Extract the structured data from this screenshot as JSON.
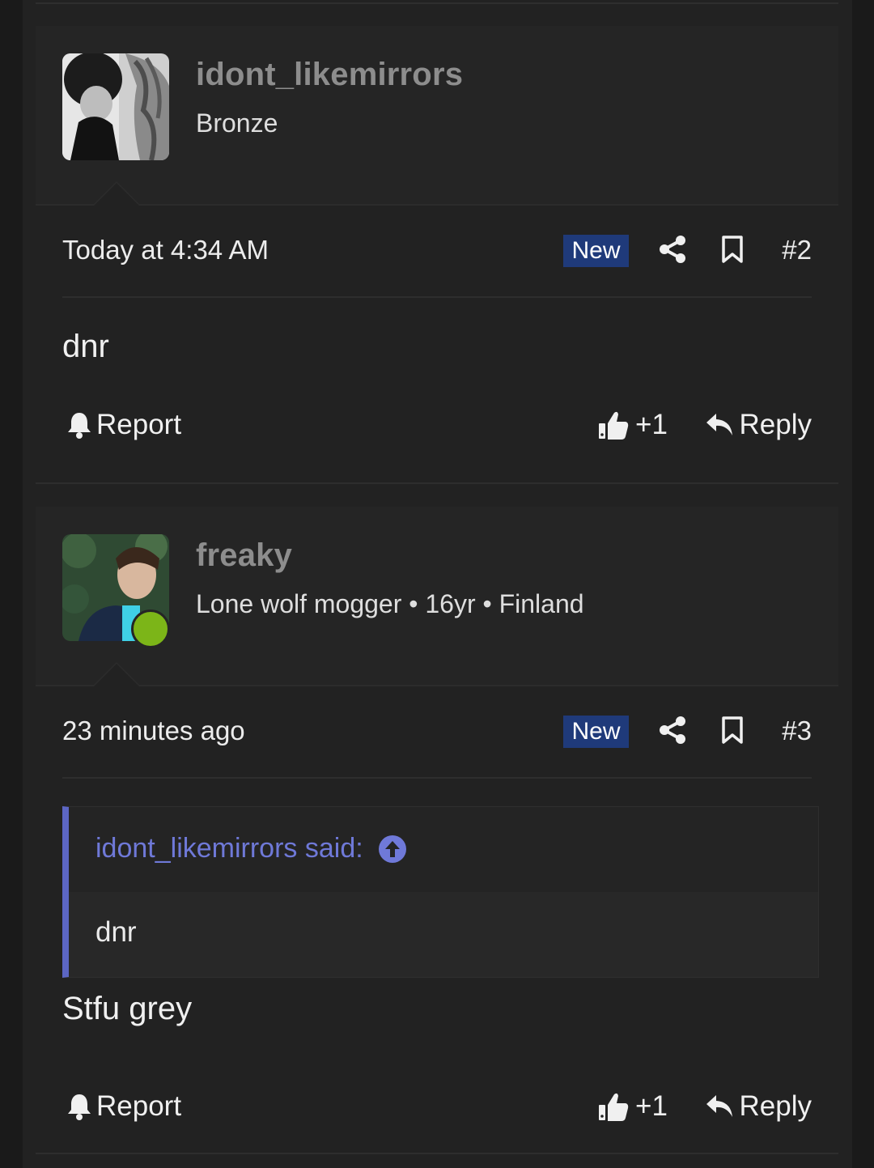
{
  "posts": [
    {
      "username": "idont_likemirrors",
      "user_title": "Bronze",
      "timestamp": "Today at 4:34 AM",
      "badge": "New",
      "number": "#2",
      "body": "dnr",
      "report_label": "Report",
      "like_count": "+1",
      "reply_label": "Reply",
      "online": false
    },
    {
      "username": "freaky",
      "user_title": "Lone wolf mogger • 16yr • Finland",
      "timestamp": "23 minutes ago",
      "badge": "New",
      "number": "#3",
      "quote": {
        "attribution": "idont_likemirrors said:",
        "text": "dnr"
      },
      "body": "Stfu grey",
      "report_label": "Report",
      "like_count": "+1",
      "reply_label": "Reply",
      "online": true
    }
  ],
  "icons": {
    "share": "share-icon",
    "bookmark": "bookmark-icon",
    "report": "bell-icon",
    "like": "thumbs-up-icon",
    "reply": "reply-arrow-icon",
    "jump": "arrow-up-circle-icon"
  },
  "colors": {
    "badge_bg": "#1f3a7a",
    "quote_accent": "#5c66c4",
    "online": "#7cb518"
  }
}
